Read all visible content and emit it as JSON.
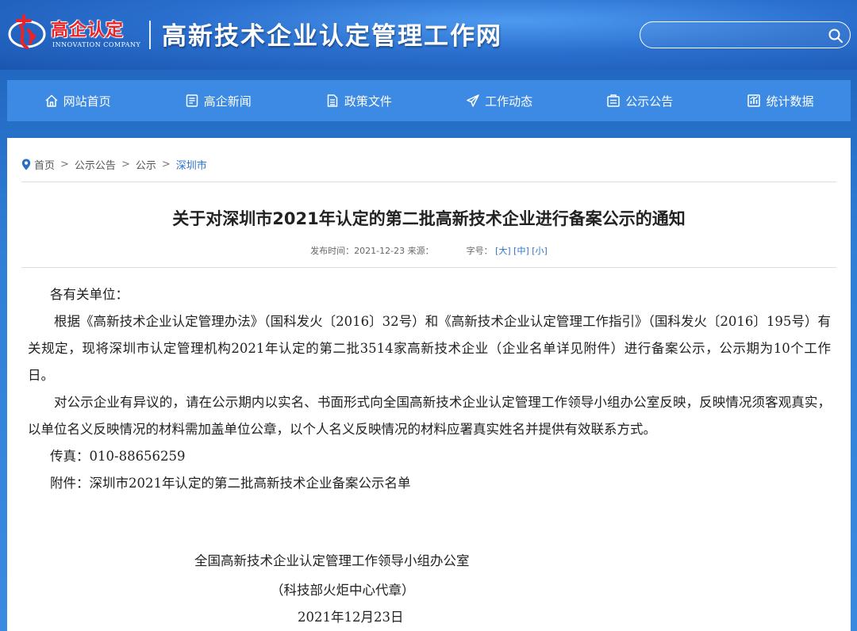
{
  "header": {
    "logo_cn": "高企认定",
    "logo_en": "INNOVATION COMPANY",
    "site_title": "高新技术企业认定管理工作网",
    "search_placeholder": "",
    "search_icon": "search-icon"
  },
  "nav": {
    "items": [
      {
        "label": "网站首页",
        "icon": "home-icon"
      },
      {
        "label": "高企新闻",
        "icon": "news-icon"
      },
      {
        "label": "政策文件",
        "icon": "document-icon"
      },
      {
        "label": "工作动态",
        "icon": "paper-plane-icon"
      },
      {
        "label": "公示公告",
        "icon": "notice-icon"
      },
      {
        "label": "统计数据",
        "icon": "chart-icon"
      }
    ]
  },
  "breadcrumb": {
    "icon": "location-pin-icon",
    "items": [
      "首页",
      "公示公告",
      "公示",
      "深圳市"
    ],
    "separator": ">"
  },
  "article": {
    "title": "关于对深圳市2021年认定的第二批高新技术企业进行备案公示的通知",
    "meta_publish": "发布时间：2021-12-23 来源：",
    "meta_fontsize_label": "字号：",
    "font_sizes": [
      "[大]",
      "[中]",
      "[小]"
    ],
    "salutation": "各有关单位：",
    "para1": "根据《高新技术企业认定管理办法》（国科发火〔2016〕32号）和《高新技术企业认定管理工作指引》（国科发火〔2016〕195号）有关规定，现将深圳市认定管理机构2021年认定的第二批3514家高新技术企业（企业名单详见附件）进行备案公示，公示期为10个工作日。",
    "para2": "对公示企业有异议的，请在公示期内以实名、书面形式向全国高新技术企业认定管理工作领导小组办公室反映，反映情况须客观真实，以单位名义反映情况的材料需加盖单位公章，以个人名义反映情况的材料应署真实姓名并提供有效联系方式。",
    "fax": "传真：010-88656259",
    "attachment_label": "附件：",
    "attachment_link": "深圳市2021年认定的第二批高新技术企业备案公示名单",
    "sign_org": "全国高新技术企业认定管理工作领导小组办公室",
    "sign_seal": "（科技部火炬中心代章）",
    "sign_date": "2021年12月23日"
  },
  "colors": {
    "nav_bg": "#3c8ae3",
    "link": "#2d73c9",
    "logo_red": "#e8232a"
  }
}
